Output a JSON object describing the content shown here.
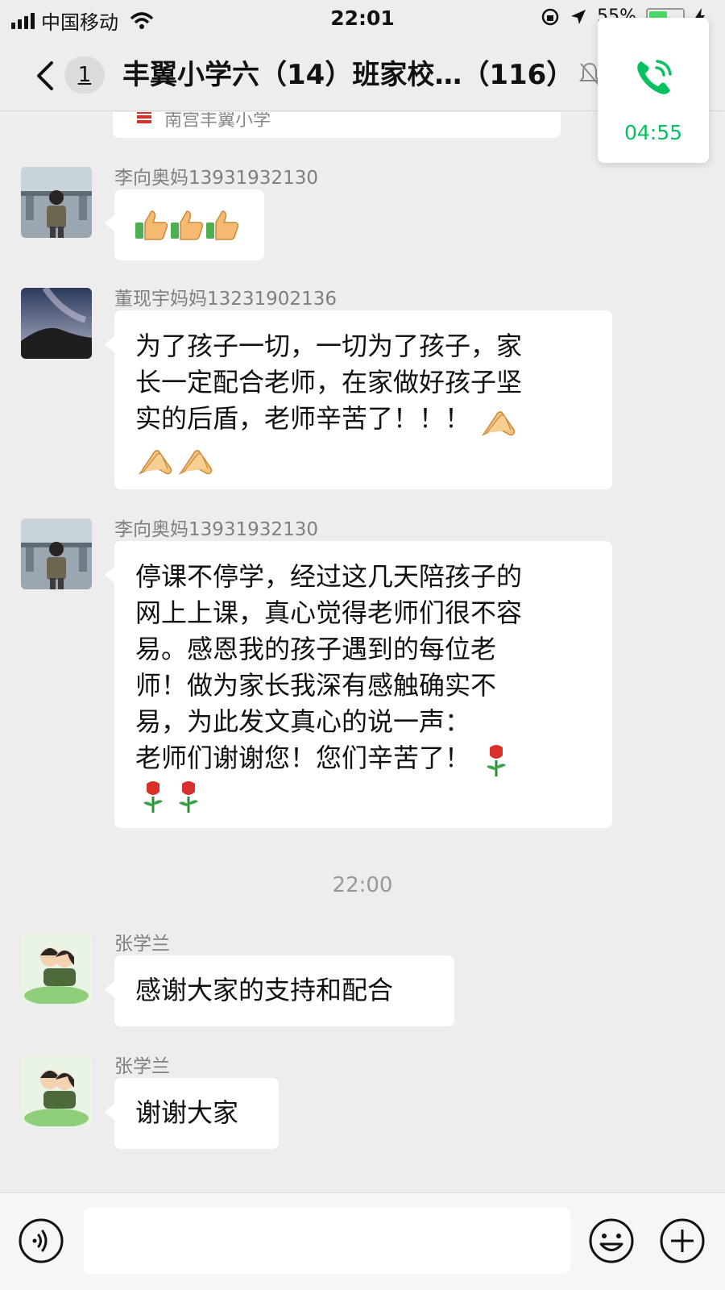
{
  "status_bar": {
    "carrier": "中国移动",
    "time": "22:01",
    "battery_text": "55%",
    "battery_level": 0.55
  },
  "nav": {
    "back_count": "1",
    "title": "丰翼小学六（14）班家校…（116）"
  },
  "call_widget": {
    "duration": "04:55"
  },
  "prev_card": {
    "source_name": "南宫丰翼小学"
  },
  "messages": [
    {
      "sender": "李向奥妈13931932130",
      "lines": []
    },
    {
      "sender": "董现宇妈妈13231902136",
      "lines": [
        "为了孩子一切，一切为了孩子，家",
        "长一定配合老师，在家做好孩子坚",
        "实的后盾，老师辛苦了！！！"
      ]
    },
    {
      "sender": "李向奥妈13931932130",
      "lines": [
        "停课不停学，经过这几天陪孩子的",
        "网上上课，真心觉得老师们很不容",
        "易。感恩我的孩子遇到的每位老",
        "师！做为家长我深有感触确实不",
        "易，为此发文真心的说一声：",
        "老师们谢谢您！您们辛苦了！"
      ]
    },
    {
      "sender": "张学兰",
      "lines": [
        "感谢大家的支持和配合"
      ]
    },
    {
      "sender": "张学兰",
      "lines": [
        "谢谢大家"
      ]
    }
  ],
  "time_divider": "22:00",
  "icons": {
    "thumbs_up": "thumbs-up-emoji",
    "clap": "clap-emoji",
    "rose": "rose-emoji"
  },
  "colors": {
    "accent_green": "#07c160",
    "background": "#ededed",
    "bubble": "#ffffff"
  }
}
